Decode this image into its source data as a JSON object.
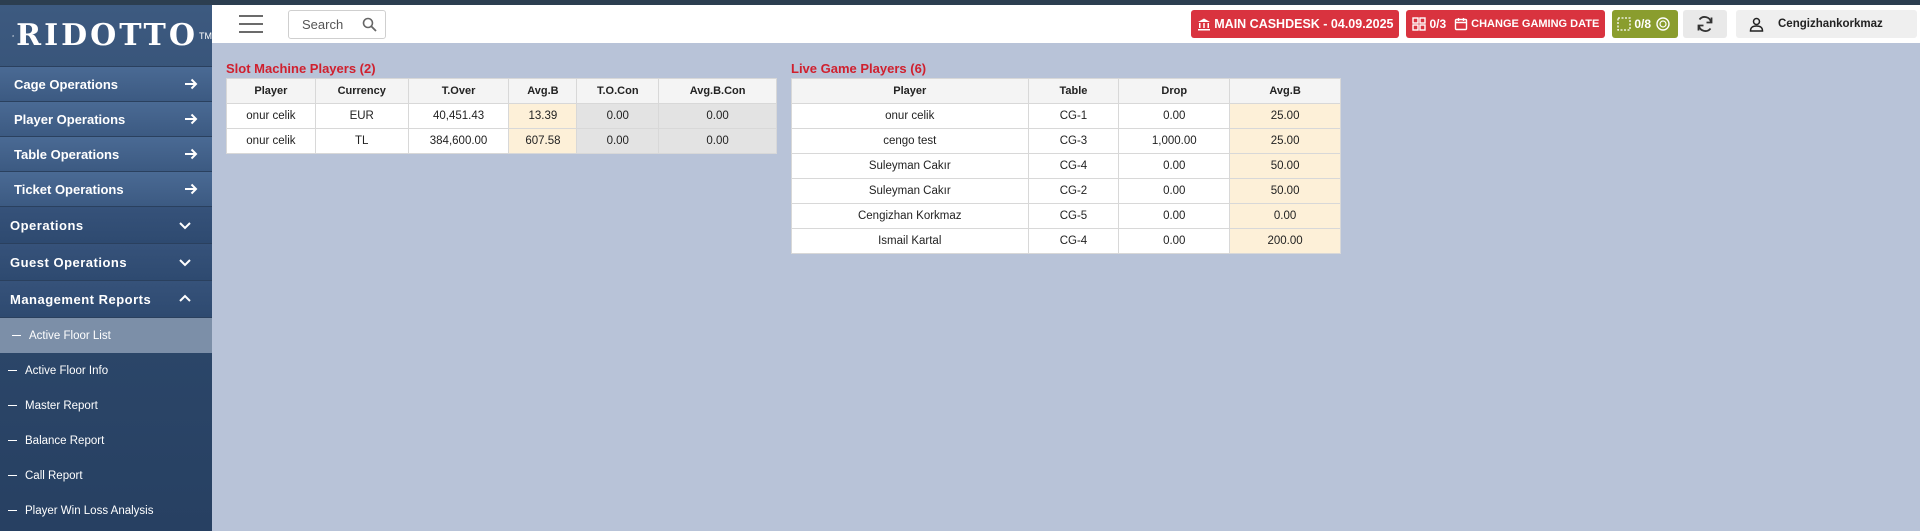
{
  "brand": {
    "name": "RIDOTTO",
    "tm": "TM"
  },
  "search": {
    "placeholder": "Search"
  },
  "header": {
    "cashdesk_label": "MAIN CASHDESK - 04.09.2025",
    "tables_count": "0/3",
    "change_gaming_date": "CHANGE GAMING DATE",
    "slots_count": "0/8",
    "username": "Cengizhankorkmaz"
  },
  "sidebar": {
    "items": [
      {
        "label": "Cage Operations"
      },
      {
        "label": "Player Operations"
      },
      {
        "label": "Table Operations"
      },
      {
        "label": "Ticket Operations"
      }
    ],
    "groups": [
      {
        "label": "Operations"
      },
      {
        "label": "Guest Operations"
      },
      {
        "label": "Management Reports"
      }
    ],
    "subitems": [
      {
        "label": "Active Floor List"
      },
      {
        "label": "Active Floor Info"
      },
      {
        "label": "Master Report"
      },
      {
        "label": "Balance Report"
      },
      {
        "label": "Call Report"
      },
      {
        "label": "Player Win Loss Analysis"
      }
    ]
  },
  "slot_players": {
    "title": "Slot Machine Players (2)",
    "columns": [
      "Player",
      "Currency",
      "T.Over",
      "Avg.B",
      "T.O.Con",
      "Avg.B.Con"
    ],
    "rows": [
      [
        "onur celik",
        "EUR",
        "40,451.43",
        "13.39",
        "0.00",
        "0.00"
      ],
      [
        "onur celik",
        "TL",
        "384,600.00",
        "607.58",
        "0.00",
        "0.00"
      ]
    ]
  },
  "live_players": {
    "title": "Live Game Players (6)",
    "columns": [
      "Player",
      "Table",
      "Drop",
      "Avg.B"
    ],
    "rows": [
      [
        "onur celik",
        "CG-1",
        "0.00",
        "25.00"
      ],
      [
        "cengo test",
        "CG-3",
        "1,000.00",
        "25.00"
      ],
      [
        "Suleyman Cakır",
        "CG-4",
        "0.00",
        "50.00"
      ],
      [
        "Suleyman Cakır",
        "CG-2",
        "0.00",
        "50.00"
      ],
      [
        "Cengizhan Korkmaz",
        "CG-5",
        "0.00",
        "0.00"
      ],
      [
        "Ismail Kartal",
        "CG-4",
        "0.00",
        "200.00"
      ]
    ]
  },
  "colors": {
    "accent_red": "#d0202e",
    "badge_red": "#d9333f",
    "badge_olive": "#8a9d2e",
    "sidebar": "#2e4a6d"
  },
  "icons": [
    "logo-icon",
    "menu-icon",
    "search-icon",
    "cashdesk-icon",
    "tables-icon",
    "calendar-icon",
    "slots-icon",
    "chip-icon",
    "sync-icon",
    "user-icon",
    "arrow-right-icon",
    "chevron-down-icon",
    "chevron-up-icon"
  ]
}
